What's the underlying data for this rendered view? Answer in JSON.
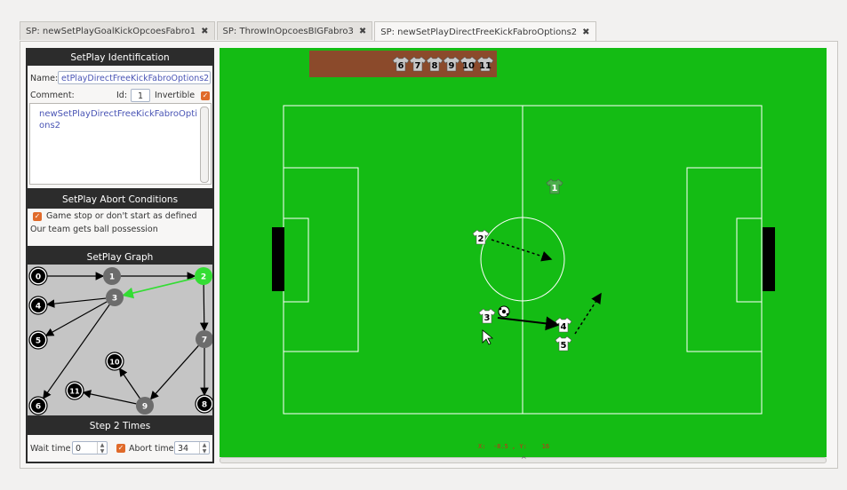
{
  "tabs": [
    {
      "label": "SP: newSetPlayGoalKickOpcoesFabro1",
      "close": "✖"
    },
    {
      "label": "SP: ThrowInOpcoesBIGFabro3",
      "close": "✖"
    },
    {
      "label": "SP: newSetPlayDirectFreeKickFabroOptions2",
      "close": "✖"
    }
  ],
  "identification": {
    "header": "SetPlay Identification",
    "name_label": "Name:",
    "name_value": "etPlayDirectFreeKickFabroOptions2",
    "comment_label": "Comment:",
    "id_label": "Id:",
    "id_value": "1",
    "invertible_label": "Invertible",
    "comment_text": "newSetPlayDirectFreeKickFabroOptions2"
  },
  "abort": {
    "header": "SetPlay Abort Conditions",
    "items": [
      "Game stop or don't start as defined",
      "Our team gets ball possession"
    ]
  },
  "graph": {
    "header": "SetPlay Graph",
    "nodes": [
      {
        "label": "0",
        "style": "ring"
      },
      {
        "label": "1",
        "style": "gray"
      },
      {
        "label": "2",
        "style": "green"
      },
      {
        "label": "3",
        "style": "gray"
      },
      {
        "label": "4",
        "style": "ring"
      },
      {
        "label": "5",
        "style": "ring"
      },
      {
        "label": "6",
        "style": "ring"
      },
      {
        "label": "7",
        "style": "gray"
      },
      {
        "label": "8",
        "style": "ring"
      },
      {
        "label": "9",
        "style": "gray"
      },
      {
        "label": "10",
        "style": "ring"
      },
      {
        "label": "11",
        "style": "ring"
      }
    ]
  },
  "times": {
    "header": "Step 2 Times",
    "wait_label": "Wait time",
    "wait_value": "0",
    "abort_label": "Abort time",
    "abort_value": "34"
  },
  "bench": {
    "numbers": [
      "6",
      "7",
      "8",
      "9",
      "10",
      "11"
    ]
  },
  "players": [
    {
      "label": "1",
      "team": "opponent"
    },
    {
      "label": "2",
      "team": "own"
    },
    {
      "label": "3",
      "team": "own"
    },
    {
      "label": "4",
      "team": "own"
    },
    {
      "label": "5",
      "team": "own"
    }
  ],
  "coords": {
    "text": "X:  -8.5 , Y:    16"
  },
  "scroll": {
    "arrow": "^"
  },
  "colors": {
    "pitch": "#14bc14",
    "active_node": "#33dd33",
    "checkbox": "#e06a2a"
  }
}
